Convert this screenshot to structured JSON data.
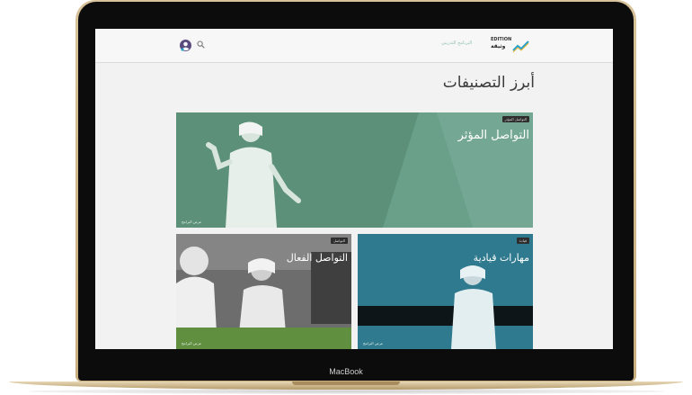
{
  "device": {
    "brand_label": "MacBook"
  },
  "header": {
    "logo_latin": "EDITION",
    "logo_arabic": "وثيقة",
    "nav_link": "البرنامج التدريبي"
  },
  "page": {
    "section_title": "أبرز التصنيفات"
  },
  "categories": [
    {
      "title": "التواصل المؤثر",
      "badge": "التواصل المؤثر",
      "footer": "عرض البرامج"
    },
    {
      "title": "التواصل الفعال",
      "badge": "التواصل",
      "footer": "عرض البرامج"
    },
    {
      "title": "مهارات قيادية",
      "badge": "قيادة",
      "footer": "عرض البرامج"
    }
  ],
  "colors": {
    "card_green": "#6aa08a",
    "card_gray": "#6d6d6d",
    "card_teal": "#2f7a8f",
    "nav_link": "#8fbfb0",
    "logo_accent": "#2aa1c9"
  },
  "icons": {
    "user": "user-icon",
    "search": "search-icon",
    "logo": "logo-icon"
  }
}
